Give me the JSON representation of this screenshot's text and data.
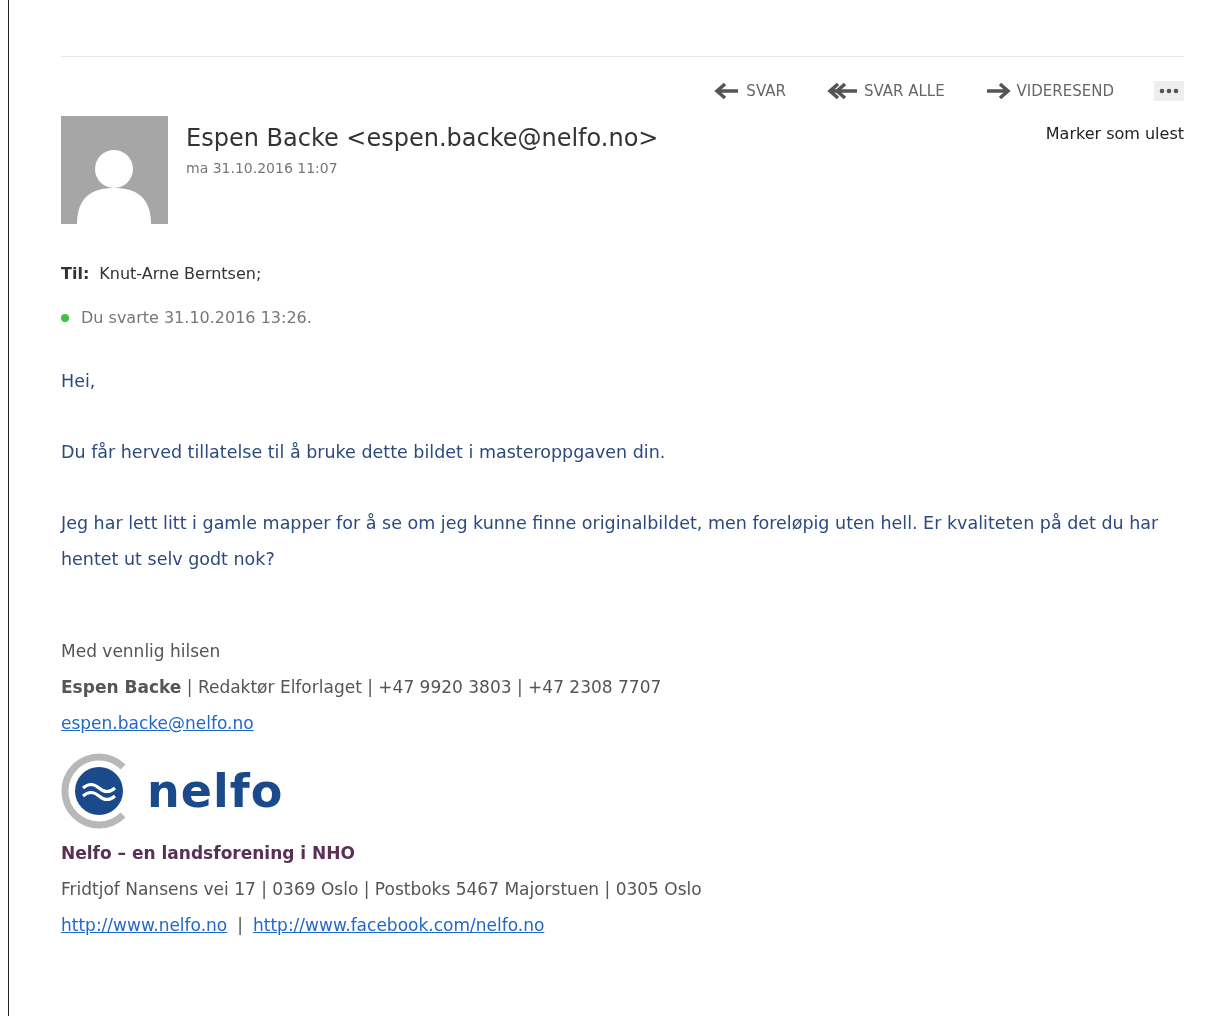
{
  "actions": [
    {
      "kind": "reply",
      "label": "SVAR"
    },
    {
      "kind": "reply-all",
      "label": "SVAR ALLE"
    },
    {
      "kind": "forward",
      "label": "VIDERESEND"
    },
    {
      "kind": "more"
    }
  ],
  "sender": {
    "name": "Espen Backe <espen.backe@nelfo.no>",
    "date": "ma 31.10.2016 11:07"
  },
  "mark_unread": "Marker som ulest",
  "to": {
    "label": "Til:",
    "value": "Knut-Arne Berntsen;"
  },
  "replied": {
    "text": "Du svarte 31.10.2016 13:26.",
    "color": "#3cc43c"
  },
  "body": [
    "Hei,",
    "Du får herved tillatelse til å bruke dette bildet i masteroppgaven din.",
    "Jeg har lett litt i gamle mapper for å se om jeg kunne finne originalbildet, men foreløpig uten hell. Er kvaliteten på det du har hentet ut selv godt nok?"
  ],
  "signature": {
    "greeting": "Med vennlig hilsen",
    "line": "**Espen Backe** | Redaktør Elforlaget | +47 9920 3803 | +47 2308 7707",
    "email": "espen.backe@nelfo.no",
    "logo_text": "nelfo",
    "org": "Nelfo – en landsforening i NHO",
    "address": "Fridtjof Nansens vei 17 | 0369 Oslo | Postboks 5467 Majorstuen | 0305 Oslo",
    "links": [
      "http://www.nelfo.no",
      "http://www.facebook.com/nelfo.no"
    ],
    "link_separator": "|"
  }
}
